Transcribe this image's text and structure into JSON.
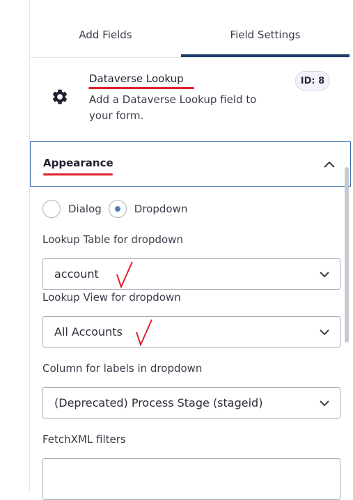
{
  "tabs": [
    {
      "label": "Add Fields"
    },
    {
      "label": "Field Settings"
    }
  ],
  "field": {
    "title": "Dataverse Lookup",
    "description": "Add a Dataverse Lookup field to your form.",
    "id_badge": "ID: 8",
    "icon": "gear-icon"
  },
  "appearance": {
    "title": "Appearance",
    "expanded": true,
    "display_mode": {
      "options": [
        "Dialog",
        "Dropdown"
      ],
      "selected": "Dropdown"
    },
    "lookup_table": {
      "label": "Lookup Table for dropdown",
      "value": "account"
    },
    "lookup_view": {
      "label": "Lookup View for dropdown",
      "value": "All Accounts"
    },
    "label_column": {
      "label": "Column for labels in dropdown",
      "value": "(Deprecated) Process Stage (stageid)"
    },
    "fetchxml": {
      "label": "FetchXML filters",
      "value": ""
    }
  },
  "colors": {
    "accent": "#1e3e6b",
    "focus_border": "#3e6fa8",
    "annotation": "#e0202a",
    "radio_dot": "#4f7fb3"
  }
}
